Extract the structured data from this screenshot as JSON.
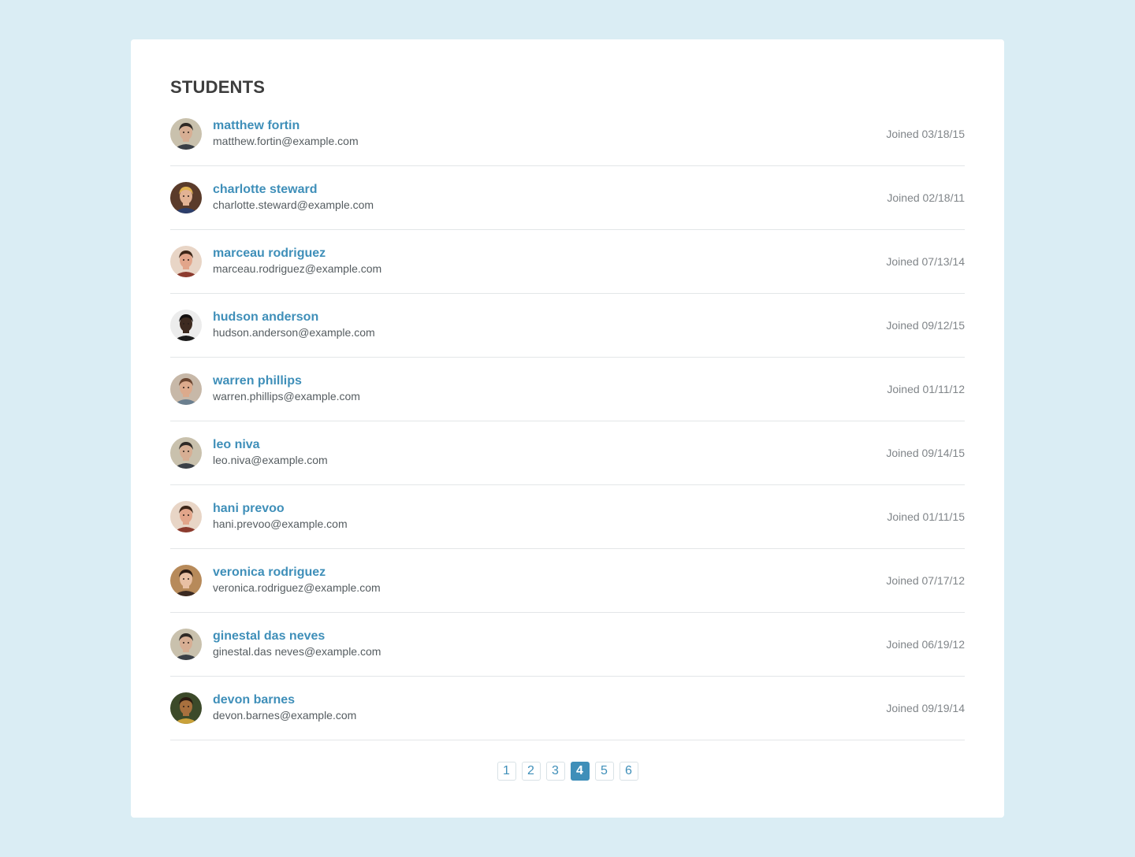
{
  "title": "STUDENTS",
  "students": [
    {
      "name": "matthew fortin",
      "email": "matthew.fortin@example.com",
      "joined": "Joined 03/18/15",
      "avatar": {
        "bg": "#c9c1ad",
        "skin": "#d7ae93",
        "hair": "#2f2a26",
        "shirt": "#3a3f46"
      }
    },
    {
      "name": "charlotte steward",
      "email": "charlotte.steward@example.com",
      "joined": "Joined 02/18/11",
      "avatar": {
        "bg": "#5a3b2a",
        "skin": "#e2b294",
        "hair": "#e0b150",
        "shirt": "#2c3e6b"
      }
    },
    {
      "name": "marceau rodriguez",
      "email": "marceau.rodriguez@example.com",
      "joined": "Joined 07/13/14",
      "avatar": {
        "bg": "#e8d5c6",
        "skin": "#e2a58a",
        "hair": "#3d2618",
        "shirt": "#8c3b2e"
      }
    },
    {
      "name": "hudson anderson",
      "email": "hudson.anderson@example.com",
      "joined": "Joined 09/12/15",
      "avatar": {
        "bg": "#ececec",
        "skin": "#3d2a20",
        "hair": "#141010",
        "shirt": "#1c1c1c"
      }
    },
    {
      "name": "warren phillips",
      "email": "warren.phillips@example.com",
      "joined": "Joined 01/11/12",
      "avatar": {
        "bg": "#c7b8a8",
        "skin": "#dcaa8c",
        "hair": "#6a4530",
        "shirt": "#6b7f8f"
      }
    },
    {
      "name": "leo niva",
      "email": "leo.niva@example.com",
      "joined": "Joined 09/14/15",
      "avatar": {
        "bg": "#c9c1ad",
        "skin": "#d7ae93",
        "hair": "#2f2a26",
        "shirt": "#3a3f46"
      }
    },
    {
      "name": "hani prevoo",
      "email": "hani.prevoo@example.com",
      "joined": "Joined 01/11/15",
      "avatar": {
        "bg": "#e8d5c6",
        "skin": "#e2a58a",
        "hair": "#3d2618",
        "shirt": "#8c3b2e"
      }
    },
    {
      "name": "veronica rodriguez",
      "email": "veronica.rodriguez@example.com",
      "joined": "Joined 07/17/12",
      "avatar": {
        "bg": "#b78a5a",
        "skin": "#e8c0a4",
        "hair": "#2a1a12",
        "shirt": "#3b2a22"
      }
    },
    {
      "name": "ginestal das neves",
      "email": "ginestal.das neves@example.com",
      "joined": "Joined 06/19/12",
      "avatar": {
        "bg": "#c9c1ad",
        "skin": "#d7ae93",
        "hair": "#2f2a26",
        "shirt": "#3a3f46"
      }
    },
    {
      "name": "devon barnes",
      "email": "devon.barnes@example.com",
      "joined": "Joined 09/19/14",
      "avatar": {
        "bg": "#3c4a2a",
        "skin": "#a8703e",
        "hair": "#2a1a10",
        "shirt": "#c9a13a"
      }
    }
  ],
  "pagination": {
    "pages": [
      "1",
      "2",
      "3",
      "4",
      "5",
      "6"
    ],
    "current": "4"
  },
  "colors": {
    "background": "#daedf4",
    "card": "#ffffff",
    "accent": "#3f8fb9",
    "title": "#3d3d3d",
    "email": "#555c60",
    "joined": "#808589",
    "divider": "#e3e6e8"
  }
}
